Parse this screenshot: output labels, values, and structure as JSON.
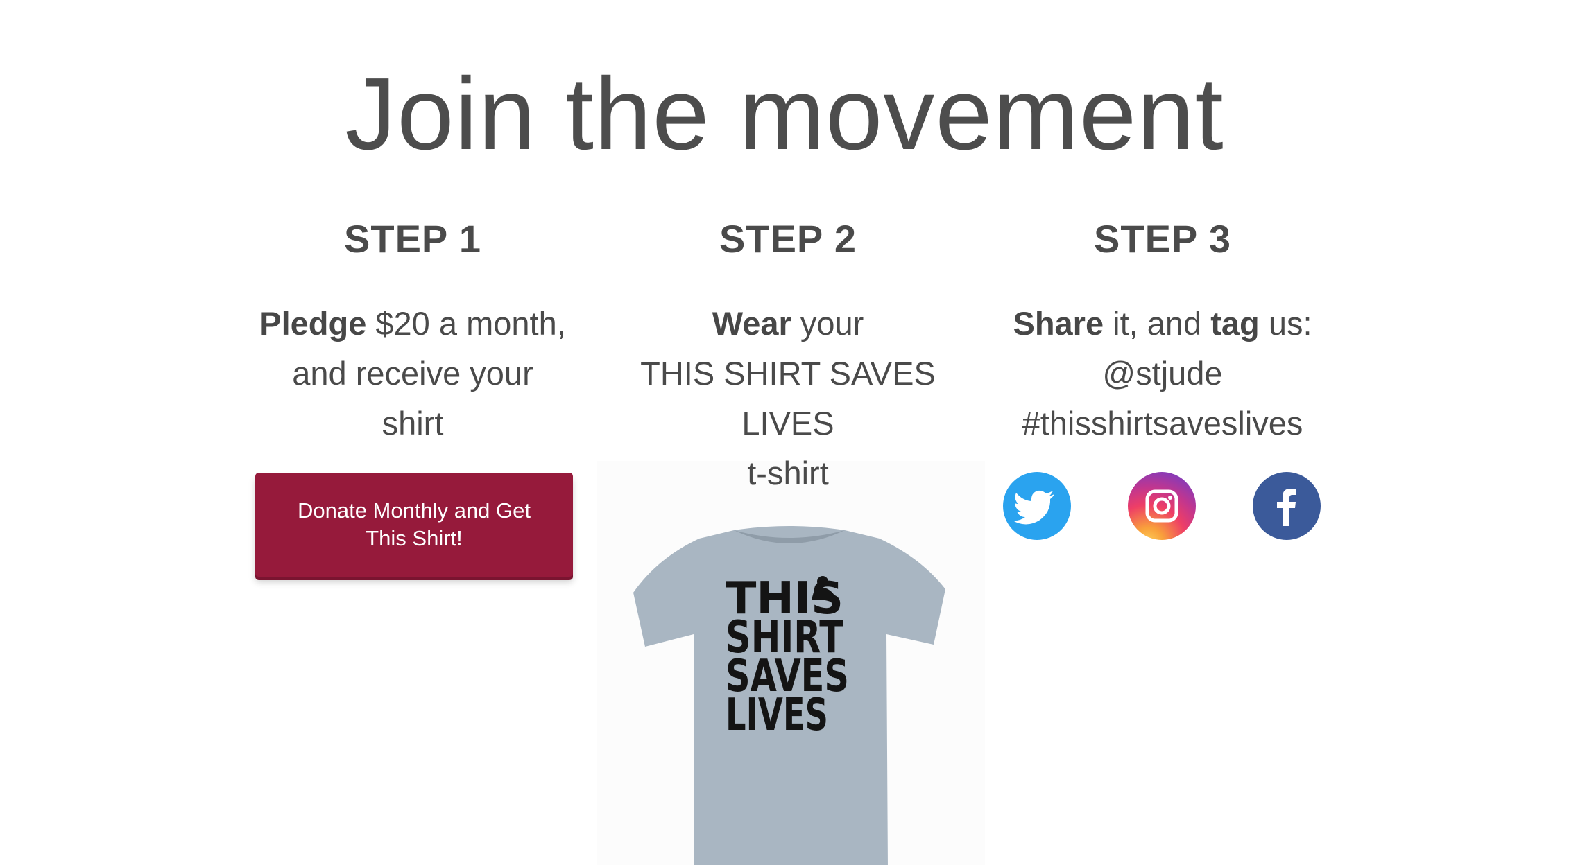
{
  "headline": "Join the movement",
  "steps": [
    {
      "title": "STEP 1",
      "line1_bold": "Pledge",
      "line1_rest": " $20 a month,",
      "line2": "and receive your",
      "line3": "shirt"
    },
    {
      "title": "STEP 2",
      "line1_bold": "Wear",
      "line1_rest": " your",
      "line2": "THIS SHIRT SAVES",
      "line3": "LIVES",
      "line4": "t-shirt"
    },
    {
      "title": "STEP 3",
      "line1_bold_a": "Share",
      "line1_mid": " it, and ",
      "line1_bold_b": "tag",
      "line1_end": " us:",
      "line2": "@stjude",
      "line3": "#thisshirtsaveslives"
    }
  ],
  "donate_button": {
    "label": "Donate Monthly and Get This Shirt!"
  },
  "shirt": {
    "print_lines": [
      "THIS",
      "SHIRT",
      "SAVES",
      "LIVES"
    ],
    "shirt_color": "#a9b6c2",
    "print_color": "#141414"
  },
  "social_icons": [
    "twitter-icon",
    "instagram-icon",
    "facebook-icon"
  ],
  "colors": {
    "button_bg": "#961a3b",
    "text": "#4a4a4a",
    "twitter": "#2aa3ef",
    "facebook": "#3b5a9a"
  }
}
